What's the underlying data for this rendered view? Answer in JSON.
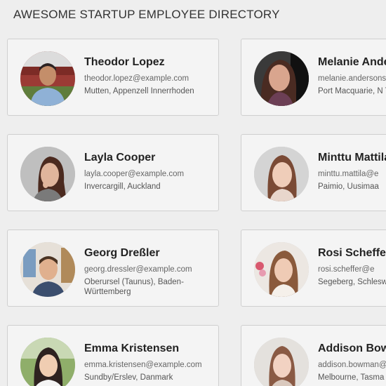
{
  "header": {
    "title": "AWESOME STARTUP EMPLOYEE DIRECTORY"
  },
  "employees": [
    {
      "name": "Theodor Lopez",
      "email": "theodor.lopez@example.com",
      "location": "Mutten, Appenzell Innerrhoden",
      "avatar": "avatar-photo"
    },
    {
      "name": "Melanie Ande",
      "email": "melanie.andersons",
      "location": "Port Macquarie, N Territory",
      "avatar": "avatar-photo"
    },
    {
      "name": "Layla Cooper",
      "email": "layla.cooper@example.com",
      "location": "Invercargill, Auckland",
      "avatar": "avatar-photo"
    },
    {
      "name": "Minttu Mattila",
      "email": "minttu.mattila@e",
      "location": "Paimio, Uusimaa",
      "avatar": "avatar-photo"
    },
    {
      "name": "Georg Dreßler",
      "email": "georg.dressler@example.com",
      "location": "Oberursel (Taunus), Baden-Württemberg",
      "avatar": "avatar-photo"
    },
    {
      "name": "Rosi Scheffer",
      "email": "rosi.scheffer@e",
      "location": "Segeberg, Schlesw",
      "avatar": "avatar-photo"
    },
    {
      "name": "Emma Kristensen",
      "email": "emma.kristensen@example.com",
      "location": "Sundby/Erslev, Danmark",
      "avatar": "avatar-photo"
    },
    {
      "name": "Addison Bowm",
      "email": "addison.bowman@",
      "location": "Melbourne, Tasma",
      "avatar": "avatar-photo"
    }
  ]
}
